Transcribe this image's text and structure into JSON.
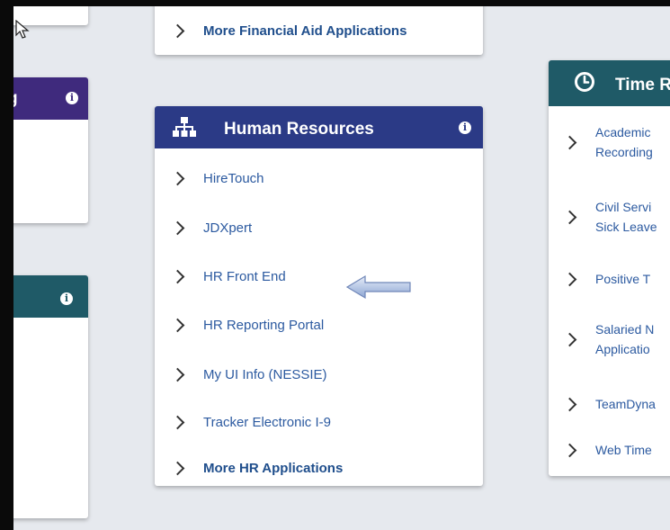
{
  "financial_aid_card": {
    "more_link": "More Financial Aid Applications"
  },
  "left_top_card": {
    "header_fragment": "g"
  },
  "human_resources": {
    "title": "Human Resources",
    "items": [
      {
        "label": "HireTouch"
      },
      {
        "label": "JDXpert"
      },
      {
        "label": "HR Front End"
      },
      {
        "label": "HR Reporting Portal"
      },
      {
        "label": "My UI Info (NESSIE)"
      },
      {
        "label": "Tracker Electronic I-9"
      }
    ],
    "more_link": "More HR Applications"
  },
  "time_card": {
    "title_fragment": "Time R",
    "items": [
      {
        "line1": "Academic",
        "line2": "Recording"
      },
      {
        "line1": "Civil Servi",
        "line2": "Sick Leave"
      },
      {
        "line1": "Positive T"
      },
      {
        "line1": "Salaried N",
        "line2": "Applicatio"
      },
      {
        "line1": "TeamDyna"
      },
      {
        "line1": "Web Time"
      }
    ]
  },
  "colors": {
    "hr_header": "#2b3a86",
    "time_header": "#1f5a67",
    "left_top_header": "#3f2a7d",
    "link": "#2c5aa0",
    "page_bg": "#e6e9ee"
  }
}
